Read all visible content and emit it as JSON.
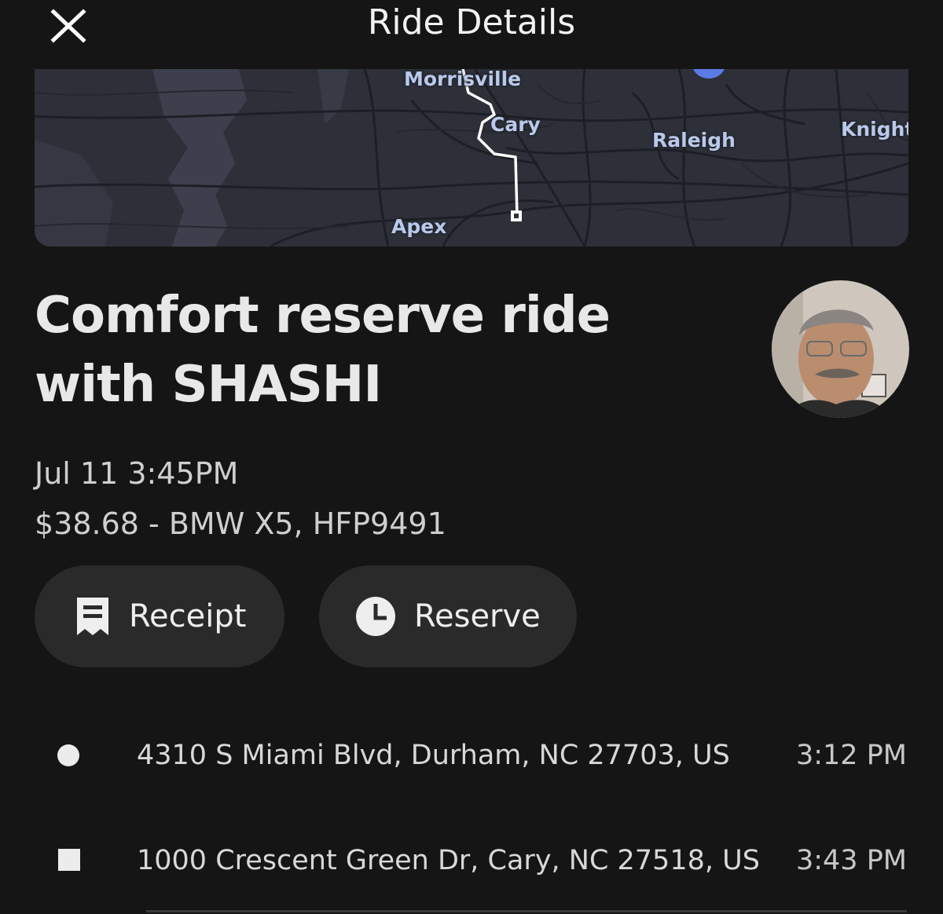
{
  "header": {
    "title": "Ride Details",
    "close_icon": "close-icon"
  },
  "map": {
    "labels": {
      "morrisville": "Morrisville",
      "cary": "Cary",
      "raleigh": "Raleigh",
      "knightdale": "Knight",
      "apex": "Apex"
    },
    "route_color": "#ffffff",
    "label_color": "#b9c9ea"
  },
  "ride": {
    "title": "Comfort reserve ride with SHASHI",
    "date": "Jul 11 3:45PM",
    "fare_vehicle": "$38.68 - BMW X5, HFP9491"
  },
  "actions": {
    "receipt": {
      "label": "Receipt",
      "icon": "receipt-icon"
    },
    "reserve": {
      "label": "Reserve",
      "icon": "clock-icon"
    }
  },
  "stops": [
    {
      "address": "4310 S Miami Blvd, Durham, NC 27703, US",
      "time": "3:12 PM",
      "marker": "pickup-circle"
    },
    {
      "address": "1000 Crescent Green Dr, Cary, NC 27518, US",
      "time": "3:43 PM",
      "marker": "dropoff-square"
    }
  ],
  "colors": {
    "background": "#151515",
    "button_bg": "#2a2a2a",
    "text_primary": "#e8e8e8"
  }
}
